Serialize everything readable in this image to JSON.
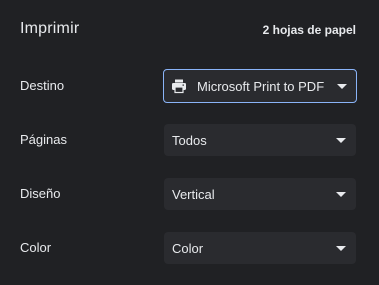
{
  "header": {
    "title": "Imprimir",
    "sheet_count": "2 hojas de papel"
  },
  "settings": [
    {
      "label": "Destino",
      "value": "Microsoft Print to PDF",
      "icon": "printer-icon"
    },
    {
      "label": "Páginas",
      "value": "Todos"
    },
    {
      "label": "Diseño",
      "value": "Vertical"
    },
    {
      "label": "Color",
      "value": "Color"
    }
  ],
  "colors": {
    "background": "#202124",
    "select_bg": "#2a2b2f",
    "focus_border": "#8ab4f8",
    "text": "#e8eaed"
  }
}
